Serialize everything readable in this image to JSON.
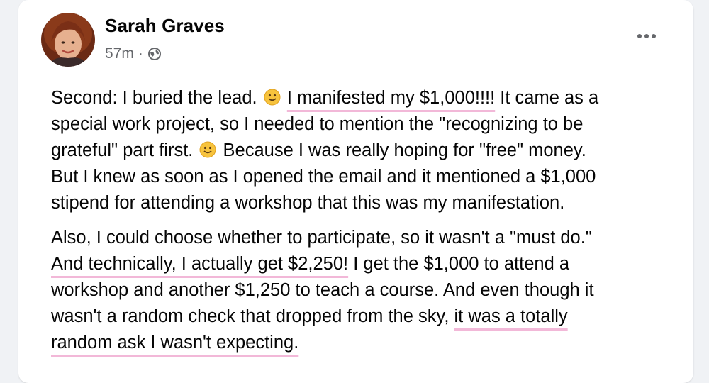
{
  "post": {
    "author_name": "Sarah Graves",
    "timestamp": "57m",
    "separator": "·",
    "audience_icon": "globe-icon",
    "menu_icon": "more-options-icon",
    "highlight_color": "#f2b8d8",
    "paragraphs": [
      {
        "lines": [
          {
            "seg1": "Second: I buried the lead. ",
            "emoji": "slightly-smiling-face-icon",
            "hl": "I manifested my $1,000!!!!",
            "seg2": " It came as a"
          },
          {
            "text": "special work project, so I needed to mention the \"recognizing to be"
          },
          {
            "seg1": "grateful\" part first. ",
            "emoji": "slightly-smiling-face-icon",
            "seg2": " Because I was really hoping for \"free\" money."
          },
          {
            "text": "But I knew as soon as I opened the email and it mentioned a $1,000"
          },
          {
            "text": "stipend for attending a workshop that this was my manifestation."
          }
        ]
      },
      {
        "lines": [
          {
            "text": "Also, I could choose whether to participate, so it wasn't a \"must do.\""
          },
          {
            "hl": "And technically, I actually get $2,250!",
            "seg2": " I get the $1,000 to attend a"
          },
          {
            "text": "workshop and another $1,250 to teach a course. And even though it"
          },
          {
            "seg1": "wasn't a random check that dropped from the sky, ",
            "hl": "it was a totally"
          },
          {
            "hl": "random ask I wasn't expecting."
          }
        ]
      }
    ]
  }
}
